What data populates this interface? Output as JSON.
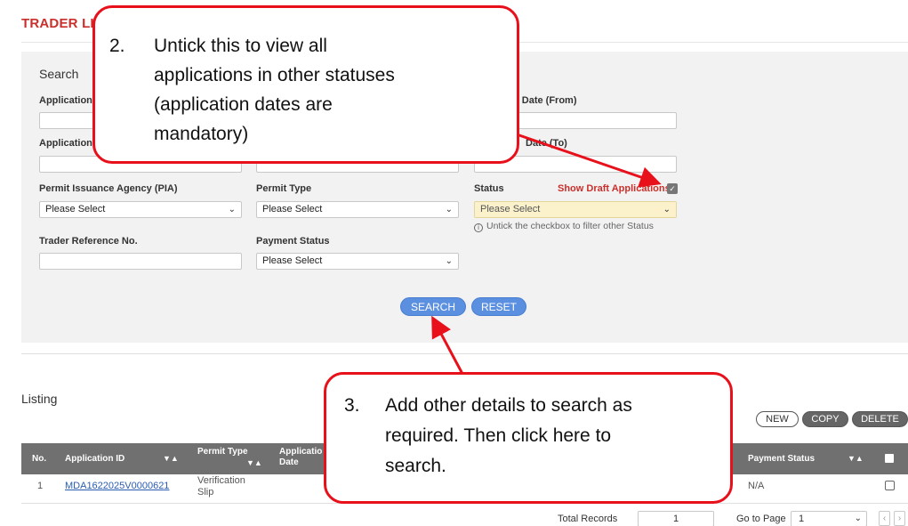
{
  "page": {
    "title": "TRADER LI"
  },
  "search": {
    "heading": "Search",
    "application_label": "Application",
    "application2_label": "Application",
    "date_from_label": "n Date (From)",
    "date_to_label": "Date (To)",
    "pia_label": "Permit Issuance Agency (PIA)",
    "pia_value": "Please Select",
    "permit_type_label": "Permit Type",
    "permit_type_value": "Please Select",
    "status_label": "Status",
    "status_value": "Please Select",
    "show_draft_label": "Show Draft Applications",
    "show_draft_checked": true,
    "hint": "Untick the checkbox to filter other Status",
    "trader_ref_label": "Trader Reference No.",
    "payment_status_label": "Payment Status",
    "payment_status_value": "Please Select",
    "search_button": "SEARCH",
    "reset_button": "RESET"
  },
  "listing": {
    "heading": "Listing",
    "new_button": "NEW",
    "copy_button": "COPY",
    "delete_button": "DELETE",
    "columns": {
      "no": "No.",
      "application_id": "Application ID",
      "permit_type": "Permit Type",
      "application_date_line1": "Applicatio",
      "application_date_line2": "Date",
      "payment_status": "Payment Status"
    },
    "sort_glyph": "▼▲",
    "rows": [
      {
        "no": "1",
        "application_id": "MDA1622025V0000621",
        "permit_type_line1": "Verification",
        "permit_type_line2": "Slip",
        "payment_status": "N/A"
      }
    ],
    "total_records_label": "Total Records",
    "total_records": "1",
    "go_to_page_label": "Go to Page",
    "page_value": "1"
  },
  "callouts": {
    "step2": {
      "number": "2.",
      "lines": [
        "Untick this to view all",
        "applications in other statuses",
        "(application dates are",
        "mandatory)"
      ]
    },
    "step3": {
      "number": "3.",
      "lines": [
        "Add other details to search as",
        "required. Then click here to",
        "search."
      ]
    }
  },
  "colors": {
    "accent_red": "#c9302c",
    "callout_red": "#e8101a",
    "button_blue": "#5b8fe0",
    "table_header": "#707070"
  }
}
